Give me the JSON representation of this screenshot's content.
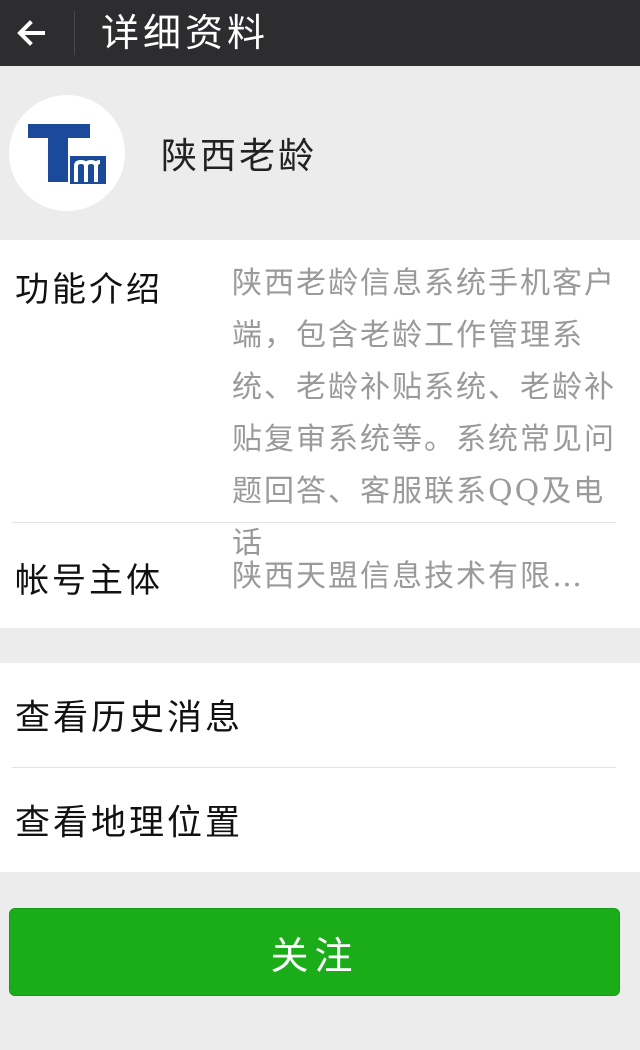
{
  "header": {
    "back_icon": "arrow-left-icon",
    "title": "详细资料"
  },
  "profile": {
    "avatar_icon": "tm-logo-icon",
    "name": "陕西老龄"
  },
  "info": {
    "function": {
      "label": "功能介绍",
      "value": "陕西老龄信息系统手机客户端，包含老龄工作管理系统、老龄补贴系统、老龄补贴复审系统等。系统常见问题回答、客服联系QQ及电话"
    },
    "account": {
      "label": "帐号主体",
      "value": "陕西天盟信息技术有限…"
    }
  },
  "actions": {
    "history": "查看历史消息",
    "location": "查看地理位置"
  },
  "follow_button": "关注",
  "colors": {
    "header_bg": "#2d2d30",
    "page_bg": "#ececec",
    "follow_green": "#1aad19",
    "logo_blue": "#1b4a9a"
  }
}
